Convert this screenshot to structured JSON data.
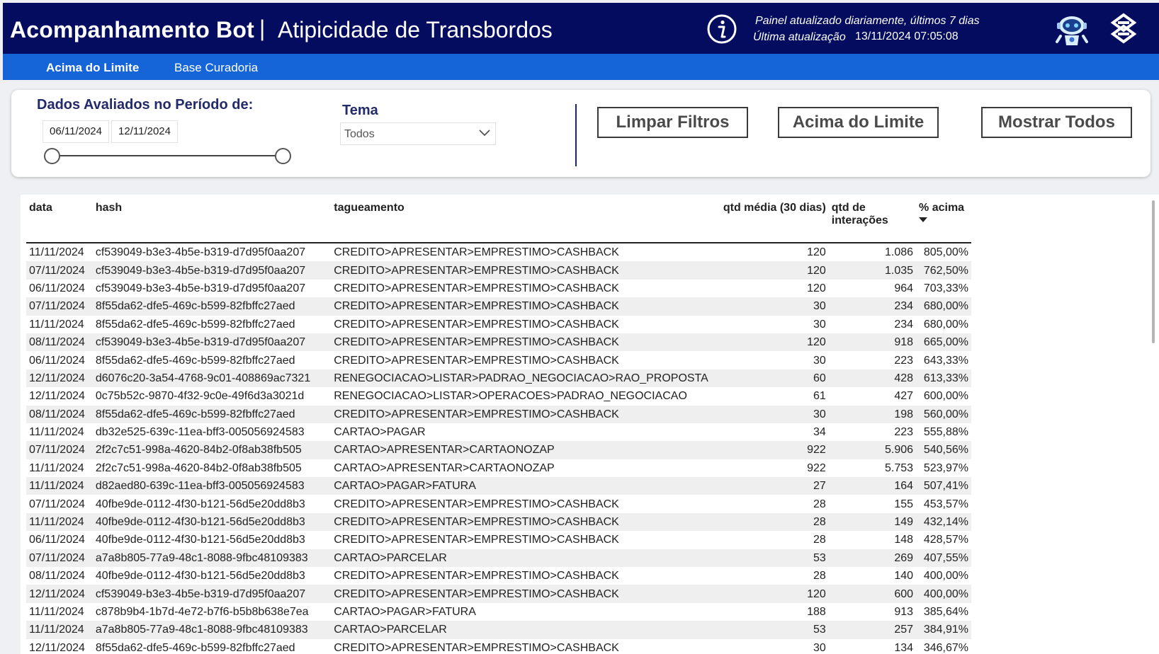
{
  "header": {
    "title_bold": "Acompanhamento Bot",
    "separator": "|",
    "title_sub": "Atipicidade de Transbordos",
    "update_note": "Painel atualizado diariamente, últimos 7 dias",
    "last_update_label": "Última atualização",
    "last_update_value": "13/11/2024 07:05:08"
  },
  "tabs": [
    {
      "label": "Acima do Limite",
      "active": true
    },
    {
      "label": "Base Curadoria",
      "active": false
    }
  ],
  "filters": {
    "period_title": "Dados Avaliados no Período de:",
    "date_start": "06/11/2024",
    "date_end": "12/11/2024",
    "tema_label": "Tema",
    "tema_value": "Todos",
    "buttons": {
      "clear": "Limpar Filtros",
      "above_limit": "Acima do Limite",
      "show_all": "Mostrar Todos"
    }
  },
  "table": {
    "columns": {
      "data": "data",
      "hash": "hash",
      "tag": "tagueamento",
      "media": "qtd média (30 dias)",
      "interacoes": "qtd de interações",
      "acima": "% acima"
    },
    "rows": [
      [
        "11/11/2024",
        "cf539049-b3e3-4b5e-b319-d7d95f0aa207",
        "CREDITO>APRESENTAR>EMPRESTIMO>CASHBACK",
        "120",
        "1.086",
        "805,00%"
      ],
      [
        "07/11/2024",
        "cf539049-b3e3-4b5e-b319-d7d95f0aa207",
        "CREDITO>APRESENTAR>EMPRESTIMO>CASHBACK",
        "120",
        "1.035",
        "762,50%"
      ],
      [
        "06/11/2024",
        "cf539049-b3e3-4b5e-b319-d7d95f0aa207",
        "CREDITO>APRESENTAR>EMPRESTIMO>CASHBACK",
        "120",
        "964",
        "703,33%"
      ],
      [
        "07/11/2024",
        "8f55da62-dfe5-469c-b599-82fbffc27aed",
        "CREDITO>APRESENTAR>EMPRESTIMO>CASHBACK",
        "30",
        "234",
        "680,00%"
      ],
      [
        "11/11/2024",
        "8f55da62-dfe5-469c-b599-82fbffc27aed",
        "CREDITO>APRESENTAR>EMPRESTIMO>CASHBACK",
        "30",
        "234",
        "680,00%"
      ],
      [
        "08/11/2024",
        "cf539049-b3e3-4b5e-b319-d7d95f0aa207",
        "CREDITO>APRESENTAR>EMPRESTIMO>CASHBACK",
        "120",
        "918",
        "665,00%"
      ],
      [
        "06/11/2024",
        "8f55da62-dfe5-469c-b599-82fbffc27aed",
        "CREDITO>APRESENTAR>EMPRESTIMO>CASHBACK",
        "30",
        "223",
        "643,33%"
      ],
      [
        "12/11/2024",
        "d6076c20-3a54-4768-9c01-408869ac7321",
        "RENEGOCIACAO>LISTAR>PADRAO_NEGOCIACAO>RAO_PROPOSTA",
        "60",
        "428",
        "613,33%"
      ],
      [
        "12/11/2024",
        "0c75b52c-9870-4f32-9c0e-49f6d3a3021d",
        "RENEGOCIACAO>LISTAR>OPERACOES>PADRAO_NEGOCIACAO",
        "61",
        "427",
        "600,00%"
      ],
      [
        "08/11/2024",
        "8f55da62-dfe5-469c-b599-82fbffc27aed",
        "CREDITO>APRESENTAR>EMPRESTIMO>CASHBACK",
        "30",
        "198",
        "560,00%"
      ],
      [
        "11/11/2024",
        "db32e525-639c-11ea-bff3-005056924583",
        "CARTAO>PAGAR",
        "34",
        "223",
        "555,88%"
      ],
      [
        "07/11/2024",
        "2f2c7c51-998a-4620-84b2-0f8ab38fb505",
        "CARTAO>APRESENTAR>CARTAONOZAP",
        "922",
        "5.906",
        "540,56%"
      ],
      [
        "11/11/2024",
        "2f2c7c51-998a-4620-84b2-0f8ab38fb505",
        "CARTAO>APRESENTAR>CARTAONOZAP",
        "922",
        "5.753",
        "523,97%"
      ],
      [
        "11/11/2024",
        "d82aed80-639c-11ea-bff3-005056924583",
        "CARTAO>PAGAR>FATURA",
        "27",
        "164",
        "507,41%"
      ],
      [
        "07/11/2024",
        "40fbe9de-0112-4f30-b121-56d5e20dd8b3",
        "CREDITO>APRESENTAR>EMPRESTIMO>CASHBACK",
        "28",
        "155",
        "453,57%"
      ],
      [
        "11/11/2024",
        "40fbe9de-0112-4f30-b121-56d5e20dd8b3",
        "CREDITO>APRESENTAR>EMPRESTIMO>CASHBACK",
        "28",
        "149",
        "432,14%"
      ],
      [
        "06/11/2024",
        "40fbe9de-0112-4f30-b121-56d5e20dd8b3",
        "CREDITO>APRESENTAR>EMPRESTIMO>CASHBACK",
        "28",
        "148",
        "428,57%"
      ],
      [
        "07/11/2024",
        "a7a8b805-77a9-48c1-8088-9fbc48109383",
        "CARTAO>PARCELAR",
        "53",
        "269",
        "407,55%"
      ],
      [
        "08/11/2024",
        "40fbe9de-0112-4f30-b121-56d5e20dd8b3",
        "CREDITO>APRESENTAR>EMPRESTIMO>CASHBACK",
        "28",
        "140",
        "400,00%"
      ],
      [
        "12/11/2024",
        "cf539049-b3e3-4b5e-b319-d7d95f0aa207",
        "CREDITO>APRESENTAR>EMPRESTIMO>CASHBACK",
        "120",
        "600",
        "400,00%"
      ],
      [
        "11/11/2024",
        "c878b9b4-1b7d-4e72-b7f6-b5b8b638e7ea",
        "CARTAO>PAGAR>FATURA",
        "188",
        "913",
        "385,64%"
      ],
      [
        "11/11/2024",
        "a7a8b805-77a9-48c1-8088-9fbc48109383",
        "CARTAO>PARCELAR",
        "53",
        "257",
        "384,91%"
      ],
      [
        "12/11/2024",
        "8f55da62-dfe5-469c-b599-82fbffc27aed",
        "CREDITO>APRESENTAR>EMPRESTIMO>CASHBACK",
        "30",
        "134",
        "346,67%"
      ]
    ]
  },
  "icons": {
    "info": "info-icon",
    "bot": "bot-icon",
    "bank_logo": "bank-logo-icon",
    "dropdown": "chevron-down-icon",
    "sort": "sort-desc-icon"
  },
  "colors": {
    "header_bg": "#030c5e",
    "tabbar_bg": "#1665d8",
    "accent_text": "#232a6b"
  }
}
